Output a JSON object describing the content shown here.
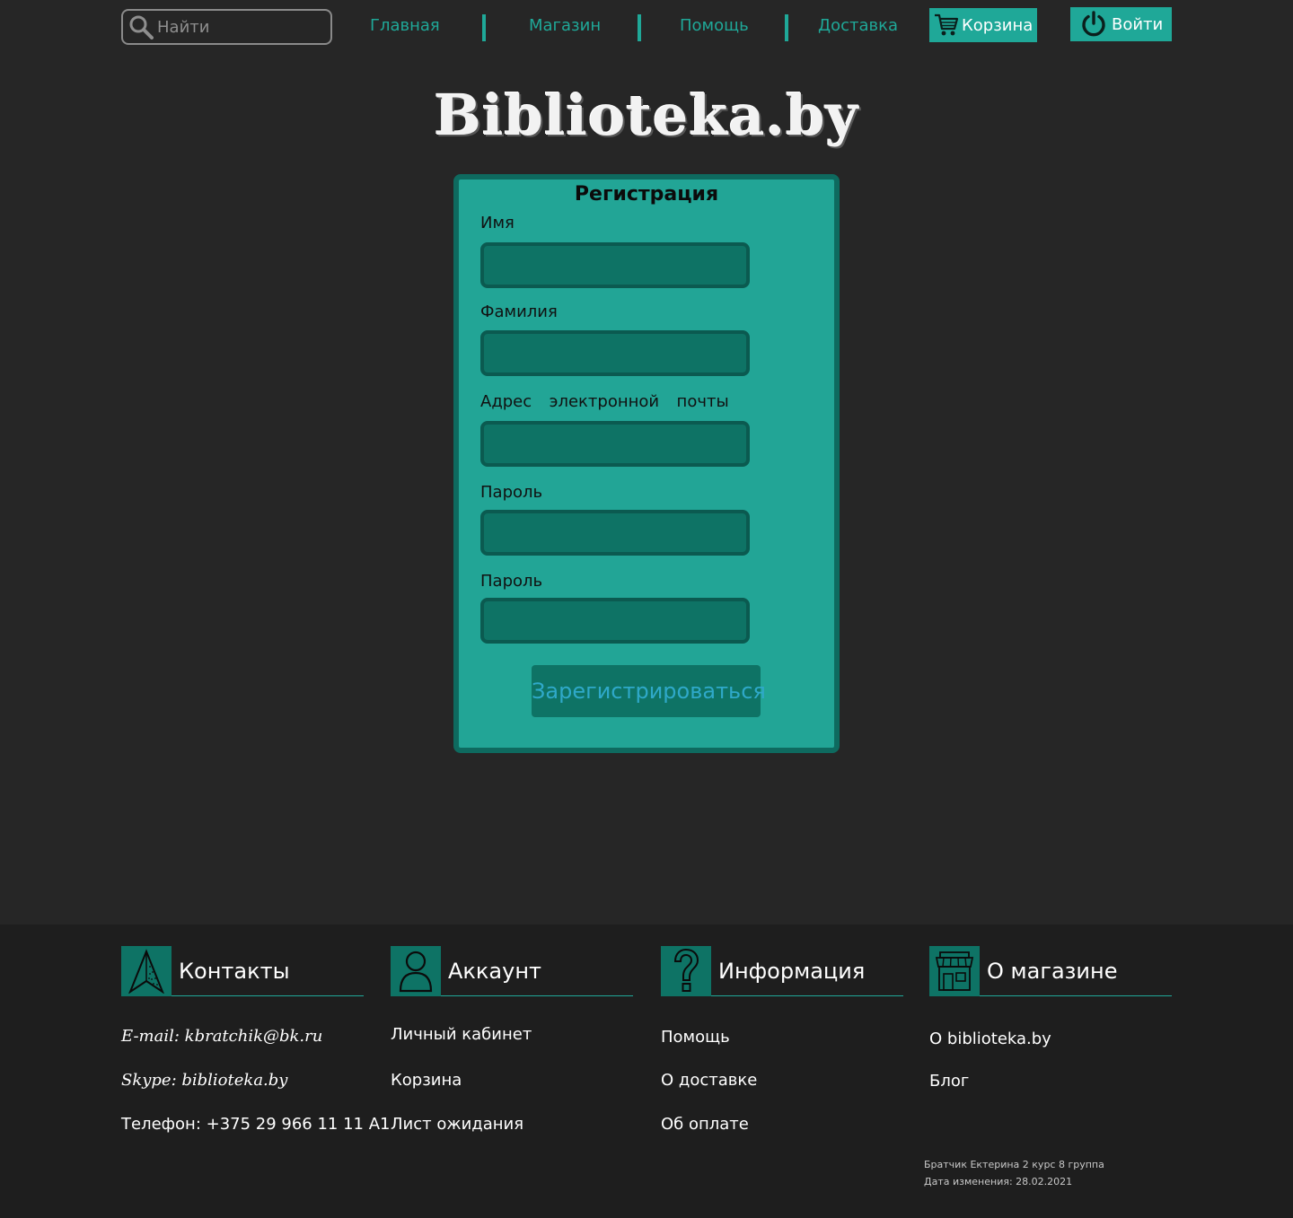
{
  "header": {
    "search_placeholder": "Найти",
    "nav": [
      "Главная",
      "Магазин",
      "Помощь",
      "Доставка"
    ],
    "cart_label": "Корзина",
    "login_label": "Войти",
    "accent_color": "#1fa898"
  },
  "logo": {
    "text": "Biblioteka.by"
  },
  "form": {
    "title": "Регистрация",
    "fields": [
      {
        "label": "Имя",
        "value": ""
      },
      {
        "label": "Фамилия",
        "value": ""
      },
      {
        "label": "Адрес  электронной  почты",
        "value": ""
      },
      {
        "label": "Пароль",
        "value": ""
      },
      {
        "label": "Пароль",
        "value": ""
      }
    ],
    "submit_label": "Зарегистрироваться"
  },
  "footer": {
    "columns": [
      {
        "title": "Контакты",
        "icon": "navigation-arrow-icon",
        "items": [
          "E-mail: kbratchik@bk.ru",
          "Skype: biblioteka.by",
          "Телефон: +375 29 966 11 11 A1"
        ]
      },
      {
        "title": "Аккаунт",
        "icon": "user-icon",
        "items": [
          "Личный кабинет",
          "Корзина",
          "Лист ожидания"
        ]
      },
      {
        "title": "Информация",
        "icon": "question-icon",
        "items": [
          "Помощь",
          "О доставке",
          "Об оплате"
        ]
      },
      {
        "title": "О магазине",
        "icon": "store-icon",
        "items": [
          "О biblioteka.by",
          "Блог"
        ]
      }
    ],
    "credits": {
      "author": "Братчик Ектерина 2 курс 8 группа",
      "updated": "Дата изменения: 28.02.2021"
    }
  }
}
